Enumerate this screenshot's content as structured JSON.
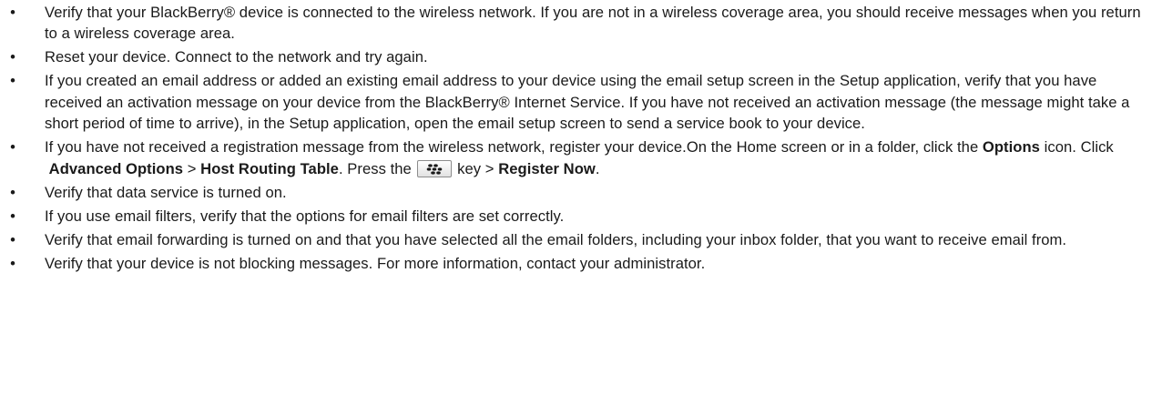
{
  "bullet_char": "•",
  "items": [
    {
      "text": "Verify that your BlackBerry® device is connected to the wireless network. If you are not in a wireless coverage area, you should receive messages when you return to a wireless coverage area."
    },
    {
      "text": "Reset your device. Connect to the network and try again."
    },
    {
      "text": "If you created an email address or added an existing email address to your device using the email setup screen in the Setup application, verify that you have received an activation message on your device from the BlackBerry® Internet Service. If you have not received an activation message (the message might take a short period of time to arrive), in the Setup application, open the email setup screen to send a service book to your device."
    },
    {
      "intro": "If you have not received a registration message from the wireless network, register your device.On the Home screen or in a folder, click the",
      "options_label": "Options",
      "icon_click": "icon. Click",
      "advanced_options_label": "Advanced Options",
      "arrow": ">",
      "host_routing_label": "Host Routing Table",
      "press_the": ". Press the",
      "key_icon": "blackberry-menu-key-icon",
      "key_arrow": "key >",
      "register_now_label": "Register Now",
      "end_period": "."
    },
    {
      "text": "Verify that data service is turned on."
    },
    {
      "text": "If you use email filters, verify that the options for email filters are set correctly."
    },
    {
      "text": "Verify that email forwarding is turned on and that you have selected all the email folders, including your inbox folder, that you want to receive email from."
    },
    {
      "text": "Verify that your device is not blocking messages. For more information, contact your administrator."
    }
  ]
}
